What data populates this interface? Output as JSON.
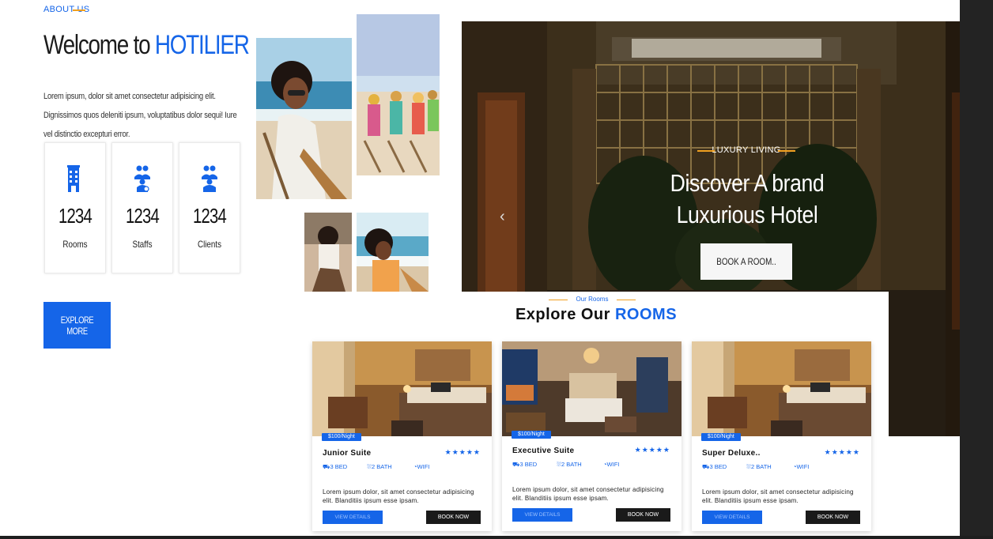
{
  "about": {
    "label": "ABOUT US",
    "welcome_prefix": "Welcome to ",
    "brand": "HOTILIER",
    "text": "Lorem ipsum, dolor sit amet consectetur adipisicing elit. Dignissimos quos deleniti ipsum, voluptatibus dolor sequi! Iure vel distinctio excepturi error.",
    "stats": [
      {
        "value": "1234",
        "label": "Rooms",
        "icon": "hotel-icon"
      },
      {
        "value": "1234",
        "label": "Staffs",
        "icon": "staff-icon"
      },
      {
        "value": "1234",
        "label": "Clients",
        "icon": "clients-icon"
      }
    ],
    "explore_button": "EXPLORE MORE"
  },
  "hero": {
    "tagline": "LUXURY LIVING",
    "title_line1": "Discover A brand",
    "title_line2": "Luxurious Hotel",
    "button": "BOOK A ROOM..",
    "prev_arrow": "‹",
    "next_arrow": "›"
  },
  "rooms": {
    "tag": "Our Rooms",
    "title_prefix": "Explore Our ",
    "title_highlight": "ROOMS",
    "cards": [
      {
        "price": "$100/Night",
        "name": "Junior Suite",
        "stars": "★★★★★",
        "bed": "3 BED",
        "bath": "2 BATH",
        "wifi": "WIFI",
        "desc": "Lorem ipsum dolor, sit amet consectetur adipisicing elit. Blanditiis ipsum esse ipsam.",
        "view": "VIEW DETAILS",
        "book": "BOOK NOW"
      },
      {
        "price": "$100/Night",
        "name": "Executive Suite",
        "stars": "★★★★★",
        "bed": "3 BED",
        "bath": "2 BATH",
        "wifi": "WIFI",
        "desc": "Lorem ipsum dolor, sit amet consectetur adipisicing elit. Blanditiis ipsum esse ipsam.",
        "view": "VIEW DETAILS",
        "book": "BOOK NOW"
      },
      {
        "price": "$100/Night",
        "name": "Super Deluxe..",
        "stars": "★★★★★",
        "bed": "3 BED",
        "bath": "2 BATH",
        "wifi": "WIFI",
        "desc": "Lorem ipsum dolor, sit amet consectetur adipisicing elit. Blanditiis ipsum esse ipsam.",
        "view": "VIEW DETAILS",
        "book": "BOOK NOW"
      }
    ]
  },
  "colors": {
    "primary": "#1565e8",
    "accent": "#f0a020",
    "dark": "#1a1a1a"
  }
}
